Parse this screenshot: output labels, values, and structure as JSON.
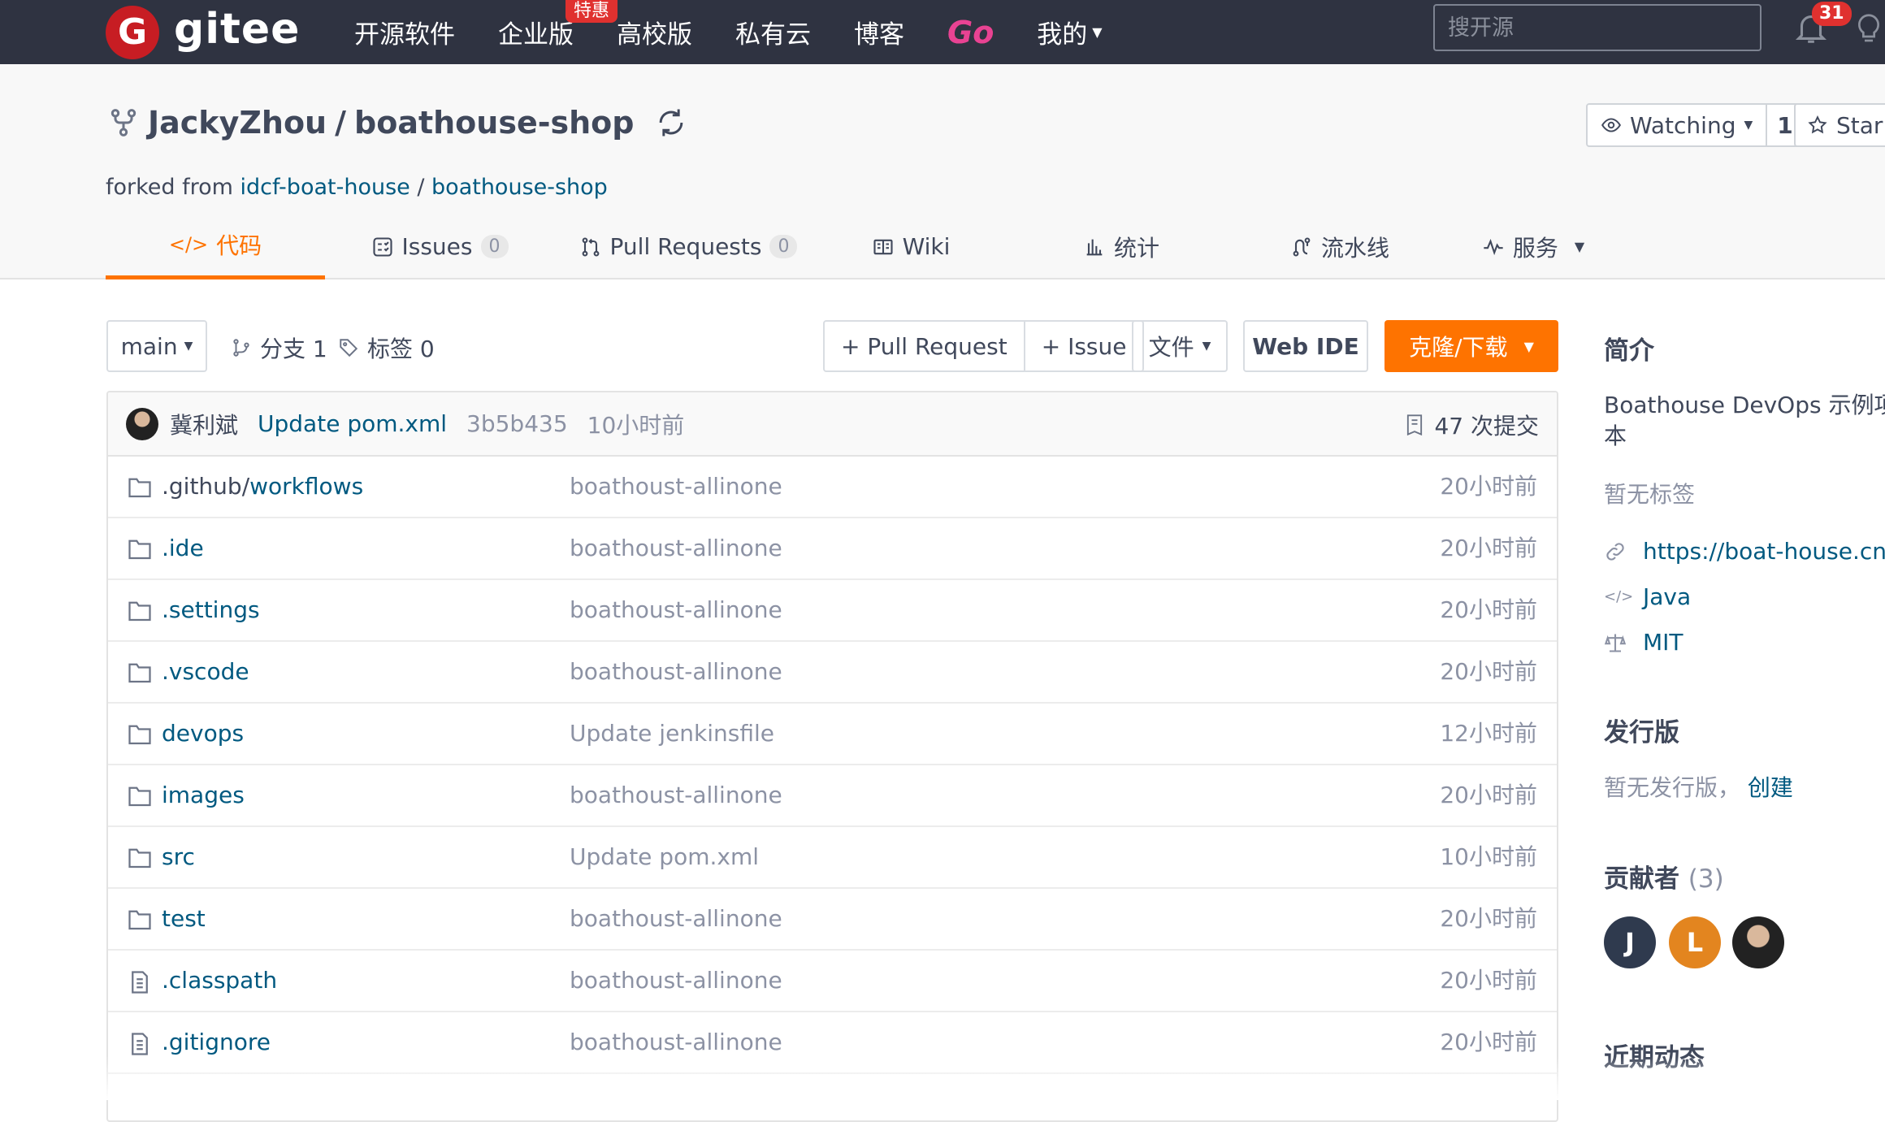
{
  "topnav": {
    "logo_text": "gitee",
    "logo_letter": "G",
    "items": [
      "开源软件",
      "企业版",
      "高校版",
      "私有云",
      "博客"
    ],
    "go_label": "Go",
    "mine_label": "我的",
    "promo_badge": "特惠",
    "search_placeholder": "搜开源",
    "notification_count": "31"
  },
  "repo": {
    "owner": "JackyZhou",
    "separator": " / ",
    "name": "boathouse-shop",
    "forked_prefix": "forked from ",
    "forked_owner": "idcf-boat-house",
    "forked_sep": " / ",
    "forked_repo": "boathouse-shop",
    "watch_label": "Watching",
    "watch_count": "1",
    "star_label": "Star"
  },
  "tabs": [
    {
      "label": "代码",
      "icon": "code-icon",
      "active": true
    },
    {
      "label": "Issues",
      "count": "0",
      "icon": "issues-icon"
    },
    {
      "label": "Pull Requests",
      "count": "0",
      "icon": "pull-request-icon"
    },
    {
      "label": "Wiki",
      "icon": "wiki-icon"
    },
    {
      "label": "统计",
      "icon": "stats-icon"
    },
    {
      "label": "流水线",
      "icon": "pipeline-icon"
    },
    {
      "label": "服务",
      "icon": "service-icon"
    }
  ],
  "toolbar": {
    "branch": "main",
    "branches_label": "分支 1",
    "tags_label": "标签 0",
    "pull_request_btn": "+ Pull Request",
    "issue_btn": "+ Issue",
    "file_btn": "文件",
    "webide_btn": "Web IDE",
    "clone_btn": "克隆/下载"
  },
  "commit": {
    "author": "冀利斌",
    "message": "Update pom.xml",
    "hash": "3b5b435",
    "time": "10小时前",
    "count_label": "47 次提交"
  },
  "files": [
    {
      "prefix": ".github/",
      "name": "workflows",
      "type": "folder",
      "message": "boathoust-allinone",
      "time": "20小时前"
    },
    {
      "prefix": "",
      "name": ".ide",
      "type": "folder",
      "message": "boathoust-allinone",
      "time": "20小时前"
    },
    {
      "prefix": "",
      "name": ".settings",
      "type": "folder",
      "message": "boathoust-allinone",
      "time": "20小时前"
    },
    {
      "prefix": "",
      "name": ".vscode",
      "type": "folder",
      "message": "boathoust-allinone",
      "time": "20小时前"
    },
    {
      "prefix": "",
      "name": "devops",
      "type": "folder",
      "message": "Update jenkinsfile",
      "time": "12小时前"
    },
    {
      "prefix": "",
      "name": "images",
      "type": "folder",
      "message": "boathoust-allinone",
      "time": "20小时前"
    },
    {
      "prefix": "",
      "name": "src",
      "type": "folder",
      "message": "Update pom.xml",
      "time": "10小时前"
    },
    {
      "prefix": "",
      "name": "test",
      "type": "folder",
      "message": "boathoust-allinone",
      "time": "20小时前"
    },
    {
      "prefix": "",
      "name": ".classpath",
      "type": "file",
      "message": "boathoust-allinone",
      "time": "20小时前"
    },
    {
      "prefix": "",
      "name": ".gitignore",
      "type": "file",
      "message": "boathoust-allinone",
      "time": "20小时前"
    }
  ],
  "sidebar": {
    "intro_title": "简介",
    "intro_line1": "Boathouse DevOps 示例项目",
    "intro_line2": "本",
    "no_tags": "暂无标签",
    "homepage": "https://boat-house.cn",
    "language": "Java",
    "license": "MIT",
    "releases_title": "发行版",
    "no_releases": "暂无发行版，",
    "create_label": "创建",
    "contributors_title": "贡献者",
    "contributors_count": "(3)",
    "contributors": [
      {
        "initial": "J",
        "color": "#2f3a4e"
      },
      {
        "initial": "L",
        "color": "#e3851f"
      },
      {
        "initial": "",
        "color": "#222222"
      }
    ],
    "activity_title": "近期动态"
  }
}
